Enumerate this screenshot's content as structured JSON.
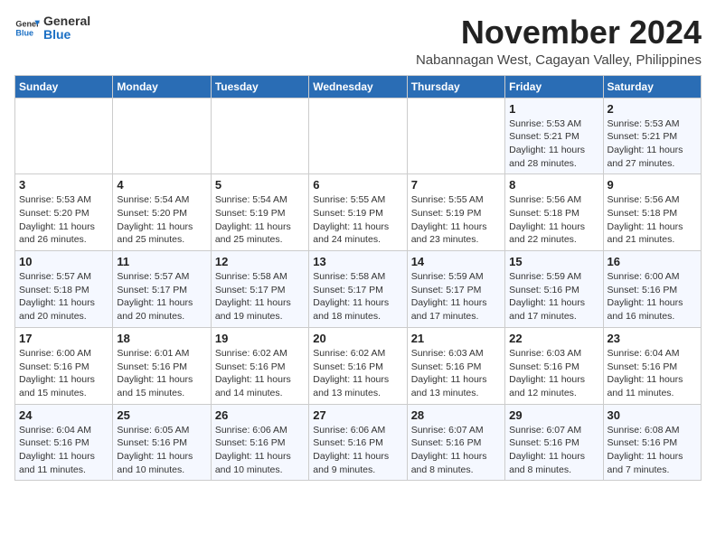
{
  "logo": {
    "name": "GeneralBlue",
    "line1": "General",
    "line2": "Blue"
  },
  "header": {
    "title": "November 2024",
    "subtitle": "Nabannagan West, Cagayan Valley, Philippines"
  },
  "weekdays": [
    "Sunday",
    "Monday",
    "Tuesday",
    "Wednesday",
    "Thursday",
    "Friday",
    "Saturday"
  ],
  "weeks": [
    [
      {
        "day": "",
        "info": ""
      },
      {
        "day": "",
        "info": ""
      },
      {
        "day": "",
        "info": ""
      },
      {
        "day": "",
        "info": ""
      },
      {
        "day": "",
        "info": ""
      },
      {
        "day": "1",
        "info": "Sunrise: 5:53 AM\nSunset: 5:21 PM\nDaylight: 11 hours and 28 minutes."
      },
      {
        "day": "2",
        "info": "Sunrise: 5:53 AM\nSunset: 5:21 PM\nDaylight: 11 hours and 27 minutes."
      }
    ],
    [
      {
        "day": "3",
        "info": "Sunrise: 5:53 AM\nSunset: 5:20 PM\nDaylight: 11 hours and 26 minutes."
      },
      {
        "day": "4",
        "info": "Sunrise: 5:54 AM\nSunset: 5:20 PM\nDaylight: 11 hours and 25 minutes."
      },
      {
        "day": "5",
        "info": "Sunrise: 5:54 AM\nSunset: 5:19 PM\nDaylight: 11 hours and 25 minutes."
      },
      {
        "day": "6",
        "info": "Sunrise: 5:55 AM\nSunset: 5:19 PM\nDaylight: 11 hours and 24 minutes."
      },
      {
        "day": "7",
        "info": "Sunrise: 5:55 AM\nSunset: 5:19 PM\nDaylight: 11 hours and 23 minutes."
      },
      {
        "day": "8",
        "info": "Sunrise: 5:56 AM\nSunset: 5:18 PM\nDaylight: 11 hours and 22 minutes."
      },
      {
        "day": "9",
        "info": "Sunrise: 5:56 AM\nSunset: 5:18 PM\nDaylight: 11 hours and 21 minutes."
      }
    ],
    [
      {
        "day": "10",
        "info": "Sunrise: 5:57 AM\nSunset: 5:18 PM\nDaylight: 11 hours and 20 minutes."
      },
      {
        "day": "11",
        "info": "Sunrise: 5:57 AM\nSunset: 5:17 PM\nDaylight: 11 hours and 20 minutes."
      },
      {
        "day": "12",
        "info": "Sunrise: 5:58 AM\nSunset: 5:17 PM\nDaylight: 11 hours and 19 minutes."
      },
      {
        "day": "13",
        "info": "Sunrise: 5:58 AM\nSunset: 5:17 PM\nDaylight: 11 hours and 18 minutes."
      },
      {
        "day": "14",
        "info": "Sunrise: 5:59 AM\nSunset: 5:17 PM\nDaylight: 11 hours and 17 minutes."
      },
      {
        "day": "15",
        "info": "Sunrise: 5:59 AM\nSunset: 5:16 PM\nDaylight: 11 hours and 17 minutes."
      },
      {
        "day": "16",
        "info": "Sunrise: 6:00 AM\nSunset: 5:16 PM\nDaylight: 11 hours and 16 minutes."
      }
    ],
    [
      {
        "day": "17",
        "info": "Sunrise: 6:00 AM\nSunset: 5:16 PM\nDaylight: 11 hours and 15 minutes."
      },
      {
        "day": "18",
        "info": "Sunrise: 6:01 AM\nSunset: 5:16 PM\nDaylight: 11 hours and 15 minutes."
      },
      {
        "day": "19",
        "info": "Sunrise: 6:02 AM\nSunset: 5:16 PM\nDaylight: 11 hours and 14 minutes."
      },
      {
        "day": "20",
        "info": "Sunrise: 6:02 AM\nSunset: 5:16 PM\nDaylight: 11 hours and 13 minutes."
      },
      {
        "day": "21",
        "info": "Sunrise: 6:03 AM\nSunset: 5:16 PM\nDaylight: 11 hours and 13 minutes."
      },
      {
        "day": "22",
        "info": "Sunrise: 6:03 AM\nSunset: 5:16 PM\nDaylight: 11 hours and 12 minutes."
      },
      {
        "day": "23",
        "info": "Sunrise: 6:04 AM\nSunset: 5:16 PM\nDaylight: 11 hours and 11 minutes."
      }
    ],
    [
      {
        "day": "24",
        "info": "Sunrise: 6:04 AM\nSunset: 5:16 PM\nDaylight: 11 hours and 11 minutes."
      },
      {
        "day": "25",
        "info": "Sunrise: 6:05 AM\nSunset: 5:16 PM\nDaylight: 11 hours and 10 minutes."
      },
      {
        "day": "26",
        "info": "Sunrise: 6:06 AM\nSunset: 5:16 PM\nDaylight: 11 hours and 10 minutes."
      },
      {
        "day": "27",
        "info": "Sunrise: 6:06 AM\nSunset: 5:16 PM\nDaylight: 11 hours and 9 minutes."
      },
      {
        "day": "28",
        "info": "Sunrise: 6:07 AM\nSunset: 5:16 PM\nDaylight: 11 hours and 8 minutes."
      },
      {
        "day": "29",
        "info": "Sunrise: 6:07 AM\nSunset: 5:16 PM\nDaylight: 11 hours and 8 minutes."
      },
      {
        "day": "30",
        "info": "Sunrise: 6:08 AM\nSunset: 5:16 PM\nDaylight: 11 hours and 7 minutes."
      }
    ]
  ]
}
